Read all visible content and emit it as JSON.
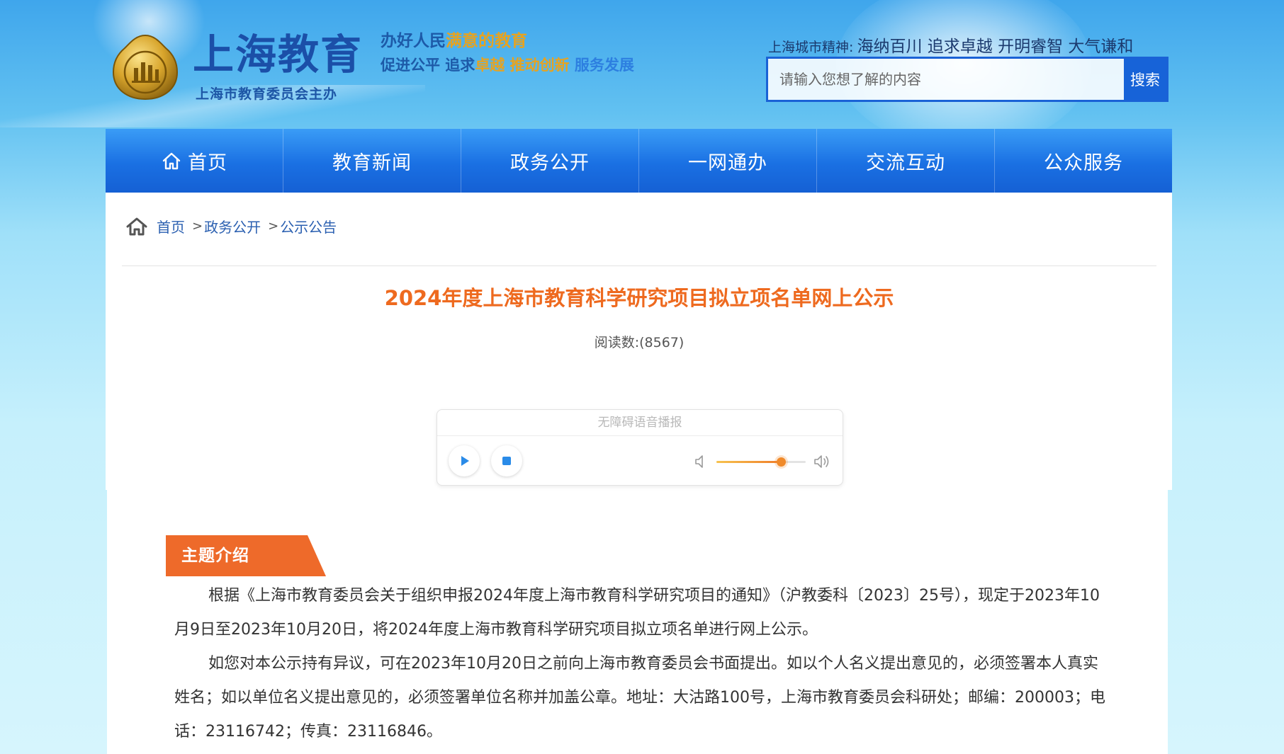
{
  "header": {
    "site_title": "上海教育",
    "site_subtitle": "上海市教育委员会主办",
    "slogan_1": {
      "part_a": "办好人民",
      "part_b": "满意的教育"
    },
    "slogan_2": {
      "part_a": "促进公平 追求",
      "part_b": "卓越 推动创新",
      "part_c": " 服务发展"
    },
    "city_spirit_label": "上海城市精神:",
    "city_spirit_value": "海纳百川 追求卓越 开明睿智 大气谦和",
    "search": {
      "placeholder": "请输入您想了解的内容",
      "button_label": "搜索"
    }
  },
  "nav": {
    "items": [
      {
        "label": "首页",
        "icon": "home-icon"
      },
      {
        "label": "教育新闻"
      },
      {
        "label": "政务公开"
      },
      {
        "label": "一网通办"
      },
      {
        "label": "交流互动"
      },
      {
        "label": "公众服务"
      }
    ]
  },
  "breadcrumb": {
    "items": [
      "首页",
      "政务公开",
      "公示公告"
    ],
    "separator": ">"
  },
  "article": {
    "title": "2024年度上海市教育科学研究项目拟立项名单网上公示",
    "read_count_label": "阅读数:",
    "read_count": "(8567)"
  },
  "player": {
    "label": "无障碍语音播报",
    "volume": 0.72,
    "accent": "#f08a2a"
  },
  "section": {
    "tab_label": "主题介绍",
    "tab_color": "#ee6a2a",
    "paragraphs": [
      "根据《上海市教育委员会关于组织申报2024年度上海市教育科学研究项目的通知》（沪教委科〔2023〕25号），现定于2023年10月9日至2023年10月20日，将2024年度上海市教育科学研究项目拟立项名单进行网上公示。",
      "如您对本公示持有异议，可在2023年10月20日之前向上海市教育委员会书面提出。如以个人名义提出意见的，必须签署本人真实姓名；如以单位名义提出意见的，必须签署单位名称并加盖公章。地址：大沽路100号，上海市教育委员会科研处；邮编：200003；电话：23116742；传真：23116846。"
    ]
  },
  "colors": {
    "nav_blue": "#1a70e3",
    "title_orange": "#ee6a1f",
    "link_blue": "#2a5fb0"
  }
}
